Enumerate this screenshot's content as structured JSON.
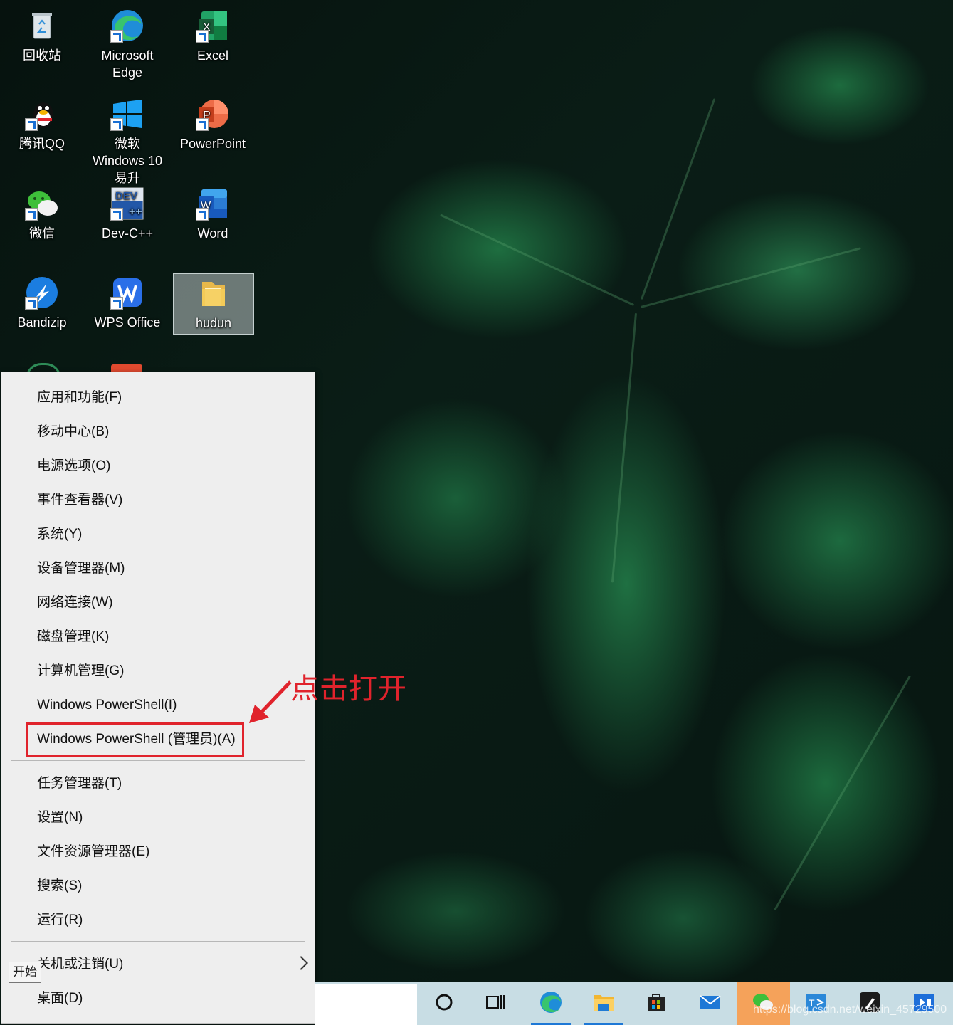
{
  "desktop": {
    "icons": [
      {
        "label": "回收站",
        "icon": "recycle-bin-icon"
      },
      {
        "label": "Microsoft Edge",
        "icon": "edge-icon"
      },
      {
        "label": "Excel",
        "icon": "excel-icon"
      },
      {
        "label": "腾讯QQ",
        "icon": "qq-icon"
      },
      {
        "label": "微软 Windows 10 易升",
        "icon": "windows-icon"
      },
      {
        "label": "PowerPoint",
        "icon": "powerpoint-icon"
      },
      {
        "label": "微信",
        "icon": "wechat-icon"
      },
      {
        "label": "Dev-C++",
        "icon": "devcpp-icon"
      },
      {
        "label": "Word",
        "icon": "word-icon"
      },
      {
        "label": "Bandizip",
        "icon": "bandizip-icon"
      },
      {
        "label": "WPS Office",
        "icon": "wps-icon"
      },
      {
        "label": "hudun",
        "icon": "folder-icon"
      }
    ]
  },
  "context_menu": {
    "items": [
      "应用和功能(F)",
      "移动中心(B)",
      "电源选项(O)",
      "事件查看器(V)",
      "系统(Y)",
      "设备管理器(M)",
      "网络连接(W)",
      "磁盘管理(K)",
      "计算机管理(G)",
      "Windows PowerShell(I)",
      "Windows PowerShell (管理员)(A)",
      "任务管理器(T)",
      "设置(N)",
      "文件资源管理器(E)",
      "搜索(S)",
      "运行(R)",
      "关机或注销(U)",
      "桌面(D)"
    ]
  },
  "annotation": {
    "text": "点击打开",
    "color": "#e0232c"
  },
  "tooltip": {
    "text": "开始"
  },
  "taskbar": {
    "buttons": [
      "cortana-icon",
      "task-view-icon",
      "edge-icon",
      "file-explorer-icon",
      "store-icon",
      "mail-icon",
      "wechat-icon",
      "teams-icon",
      "pen-icon",
      "video-icon"
    ]
  },
  "watermark": {
    "text": "https://blog.csdn.net/weixin_45729500"
  }
}
